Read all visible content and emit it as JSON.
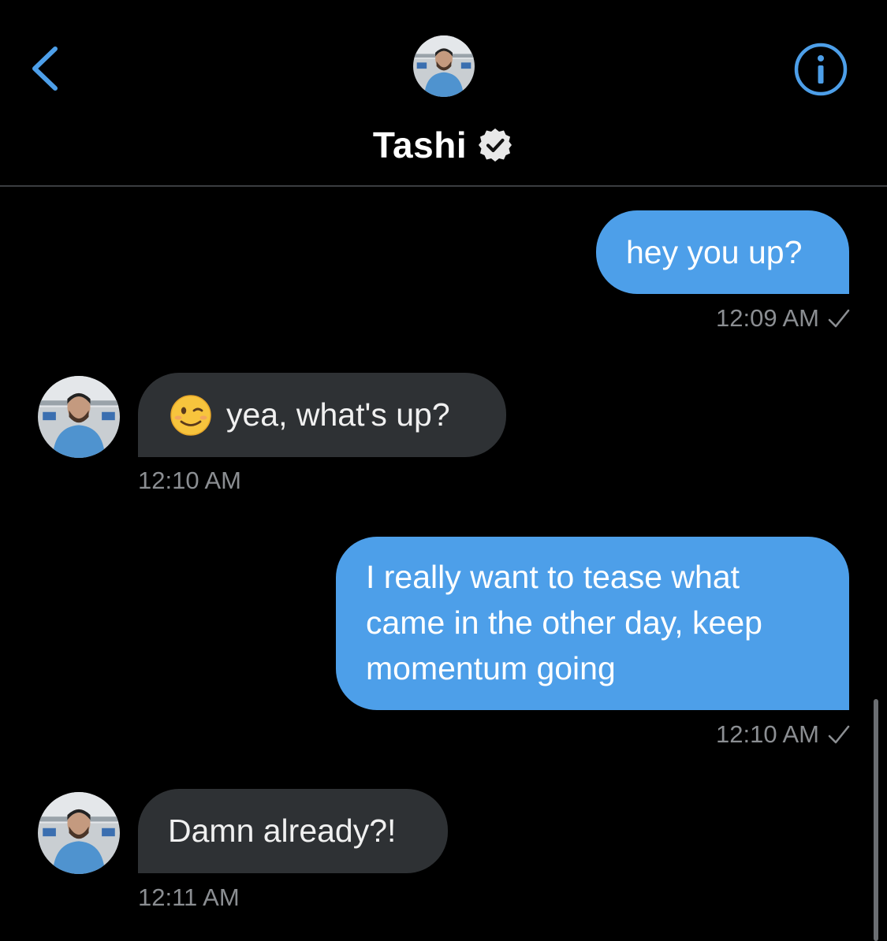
{
  "header": {
    "contact_name": "Tashi",
    "back_icon": "chevron-left-icon",
    "info_icon": "info-circle-icon",
    "verified_icon": "verified-badge-icon",
    "accent_color": "#4d9fe9"
  },
  "messages": [
    {
      "direction": "outgoing",
      "text": "hey you up?",
      "time": "12:09 AM",
      "status_icon": "checkmark-icon"
    },
    {
      "direction": "incoming",
      "emoji": "winking-face-emoji",
      "text": "yea, what's up?",
      "time": "12:10 AM"
    },
    {
      "direction": "outgoing",
      "text": "I really want to tease what came in the other day, keep momentum going",
      "time": "12:10 AM",
      "status_icon": "checkmark-icon"
    },
    {
      "direction": "incoming",
      "text": "Damn already?!",
      "time": "12:11 AM"
    }
  ],
  "colors": {
    "outgoing_bubble": "#4d9fe9",
    "incoming_bubble": "#2e3134",
    "timestamp": "#8b8e92",
    "background": "#000000"
  }
}
